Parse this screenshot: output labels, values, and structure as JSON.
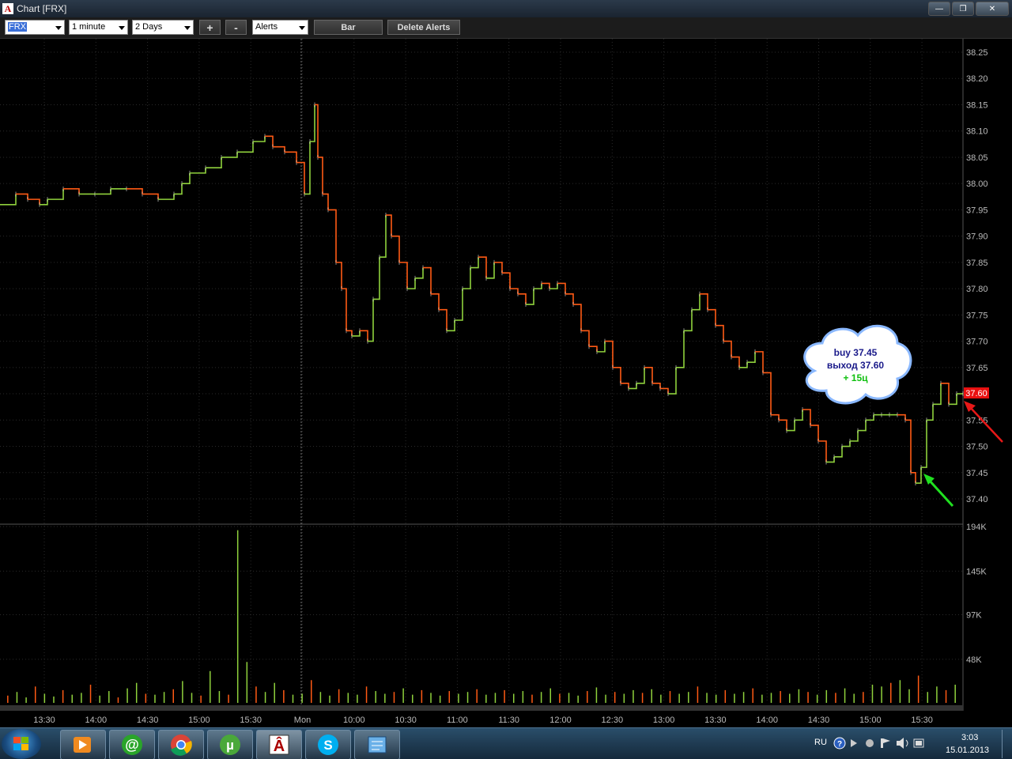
{
  "window": {
    "title": "Chart [FRX]",
    "logo_letter": "A",
    "minimize": "—",
    "maximize": "❐",
    "close": "✕"
  },
  "toolbar": {
    "symbol": "FRX",
    "interval": "1 minute",
    "range": "2 Days",
    "zoom_in": "+",
    "zoom_out": "-",
    "alerts": "Alerts",
    "bar": "Bar",
    "delete_alerts": "Delete Alerts"
  },
  "chart_data": {
    "type": "line",
    "price_axis": {
      "ticks": [
        "38.25",
        "38.20",
        "38.15",
        "38.10",
        "38.05",
        "38.00",
        "37.95",
        "37.90",
        "37.85",
        "37.80",
        "37.75",
        "37.70",
        "37.65",
        "37.60",
        "37.55",
        "37.50",
        "37.45",
        "37.40"
      ],
      "ylim": [
        37.4,
        38.25
      ],
      "current_price": "37.60"
    },
    "volume_axis": {
      "ticks": [
        "194K",
        "145K",
        "97K",
        "48K"
      ],
      "ylim": [
        0,
        194
      ]
    },
    "time_labels": [
      "13:30",
      "14:00",
      "14:30",
      "15:00",
      "15:30",
      "Mon",
      "10:00",
      "10:30",
      "11:00",
      "11:30",
      "12:00",
      "12:30",
      "13:00",
      "13:30",
      "14:00",
      "14:30",
      "15:00",
      "15:30"
    ],
    "session_break": "Mon",
    "series": [
      {
        "x": [
          0,
          20,
          35,
          50,
          60,
          80,
          100,
          120,
          140,
          160,
          180,
          200,
          220,
          230,
          240,
          260,
          280,
          300,
          320,
          335,
          345,
          360,
          375,
          385,
          392,
          398,
          402,
          408,
          415,
          425,
          432,
          438,
          445,
          455,
          465,
          472,
          480,
          488,
          495,
          505,
          515,
          525,
          535,
          545,
          555,
          565,
          575,
          585,
          595,
          605,
          615,
          625,
          635,
          645,
          655,
          665,
          675,
          685,
          695,
          705,
          715,
          725,
          735,
          745,
          755,
          765,
          775,
          785,
          795,
          805,
          815,
          825,
          835,
          845,
          855,
          865,
          875,
          885,
          895,
          905,
          915,
          925,
          935,
          945,
          955,
          965,
          975,
          985,
          995,
          1005,
          1015,
          1025,
          1035,
          1045,
          1055,
          1065,
          1075,
          1085,
          1095,
          1105,
          1115,
          1125,
          1135,
          1145,
          1152,
          1158,
          1165,
          1172,
          1180,
          1190,
          1200,
          1210,
          1218
        ],
        "values": [
          37.96,
          37.98,
          37.97,
          37.96,
          37.97,
          37.99,
          37.98,
          37.98,
          37.99,
          37.99,
          37.98,
          37.97,
          37.98,
          38.0,
          38.02,
          38.03,
          38.05,
          38.06,
          38.08,
          38.09,
          38.07,
          38.06,
          38.04,
          37.98,
          38.08,
          38.15,
          38.05,
          37.98,
          37.95,
          37.85,
          37.8,
          37.72,
          37.71,
          37.72,
          37.7,
          37.78,
          37.86,
          37.94,
          37.9,
          37.85,
          37.8,
          37.82,
          37.84,
          37.79,
          37.76,
          37.72,
          37.74,
          37.8,
          37.84,
          37.86,
          37.82,
          37.85,
          37.83,
          37.8,
          37.79,
          37.77,
          37.8,
          37.81,
          37.8,
          37.81,
          37.79,
          37.77,
          37.72,
          37.69,
          37.68,
          37.7,
          37.65,
          37.62,
          37.61,
          37.62,
          37.65,
          37.62,
          37.61,
          37.6,
          37.65,
          37.72,
          37.76,
          37.79,
          37.76,
          37.73,
          37.7,
          37.67,
          37.65,
          37.66,
          37.68,
          37.64,
          37.56,
          37.55,
          37.53,
          37.55,
          37.57,
          37.54,
          37.51,
          37.47,
          37.48,
          37.5,
          37.51,
          37.53,
          37.55,
          37.56,
          37.56,
          37.56,
          37.56,
          37.55,
          37.45,
          37.43,
          37.46,
          37.55,
          37.58,
          37.62,
          37.58,
          37.6,
          37.6
        ]
      }
    ],
    "volume": [
      8,
      12,
      6,
      18,
      10,
      7,
      14,
      9,
      11,
      20,
      8,
      13,
      6,
      16,
      22,
      10,
      9,
      12,
      15,
      24,
      11,
      8,
      35,
      13,
      9,
      190,
      45,
      18,
      12,
      22,
      14,
      9,
      10,
      25,
      12,
      8,
      15,
      11,
      9,
      18,
      13,
      10,
      12,
      16,
      9,
      14,
      11,
      8,
      13,
      10,
      12,
      15,
      9,
      11,
      14,
      10,
      13,
      9,
      12,
      16,
      10,
      11,
      8,
      13,
      17,
      9,
      12,
      10,
      14,
      11,
      15,
      9,
      13,
      10,
      12,
      18,
      11,
      9,
      14,
      10,
      12,
      16,
      9,
      11,
      13,
      10,
      15,
      12,
      9,
      14,
      11,
      16,
      10,
      12,
      20,
      18,
      22,
      25,
      15,
      30,
      12,
      18,
      14,
      20
    ],
    "annotation": {
      "line1": "buy 37.45",
      "line2": "выход 37.60",
      "line3": "+ 15ц"
    },
    "colors": {
      "up": "#8fd13c",
      "down": "#ff5a14",
      "current_price_bg": "#e81010",
      "arrow_buy": "#20e020",
      "arrow_sell": "#e81818"
    }
  },
  "taskbar": {
    "language": "RU",
    "time": "3:03",
    "date": "15.01.2013",
    "apps": [
      "media-player",
      "mail-agent",
      "chrome",
      "utorrent",
      "chart-app",
      "skype",
      "text-editor"
    ]
  }
}
